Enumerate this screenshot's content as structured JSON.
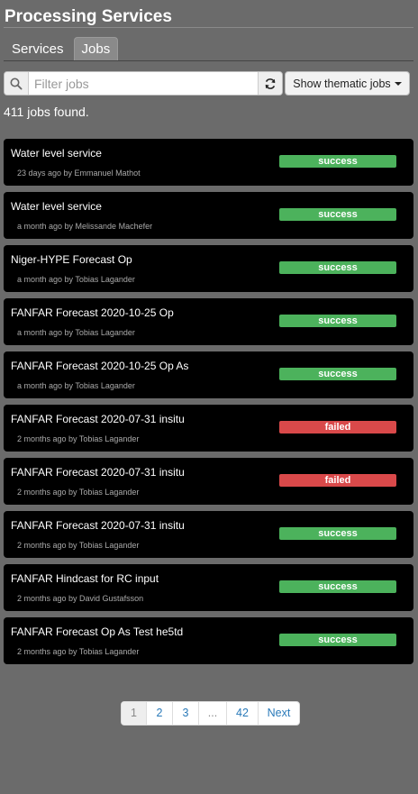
{
  "header": {
    "title": "Processing Services"
  },
  "tabs": [
    {
      "label": "Services",
      "active": false
    },
    {
      "label": "Jobs",
      "active": true
    }
  ],
  "search": {
    "placeholder": "Filter jobs",
    "value": ""
  },
  "thematic_button": {
    "label": "Show thematic jobs"
  },
  "results": {
    "count_text": "411 jobs found."
  },
  "jobs": [
    {
      "title": "Water level service",
      "meta": "23 days ago by Emmanuel Mathot",
      "status": "success"
    },
    {
      "title": "Water level service",
      "meta": "a month ago by Melissande Machefer",
      "status": "success"
    },
    {
      "title": "Niger-HYPE Forecast Op",
      "meta": "a month ago by Tobias Lagander",
      "status": "success"
    },
    {
      "title": "FANFAR Forecast 2020-10-25 Op",
      "meta": "a month ago by Tobias Lagander",
      "status": "success"
    },
    {
      "title": "FANFAR Forecast 2020-10-25 Op As",
      "meta": "a month ago by Tobias Lagander",
      "status": "success"
    },
    {
      "title": "FANFAR Forecast 2020-07-31 insitu",
      "meta": "2 months ago by Tobias Lagander",
      "status": "failed"
    },
    {
      "title": "FANFAR Forecast 2020-07-31 insitu",
      "meta": "2 months ago by Tobias Lagander",
      "status": "failed"
    },
    {
      "title": "FANFAR Forecast 2020-07-31 insitu",
      "meta": "2 months ago by Tobias Lagander",
      "status": "success"
    },
    {
      "title": "FANFAR Hindcast for RC input",
      "meta": "2 months ago by David Gustafsson",
      "status": "success"
    },
    {
      "title": "FANFAR Forecast Op As Test he5td",
      "meta": "2 months ago by Tobias Lagander",
      "status": "success"
    }
  ],
  "pagination": {
    "pages": [
      "1",
      "2",
      "3",
      "...",
      "42",
      "Next"
    ],
    "current": "1"
  },
  "colors": {
    "success": "#4cb25c",
    "failed": "#d9494a",
    "background": "#6b6b6b",
    "card": "#000000"
  }
}
